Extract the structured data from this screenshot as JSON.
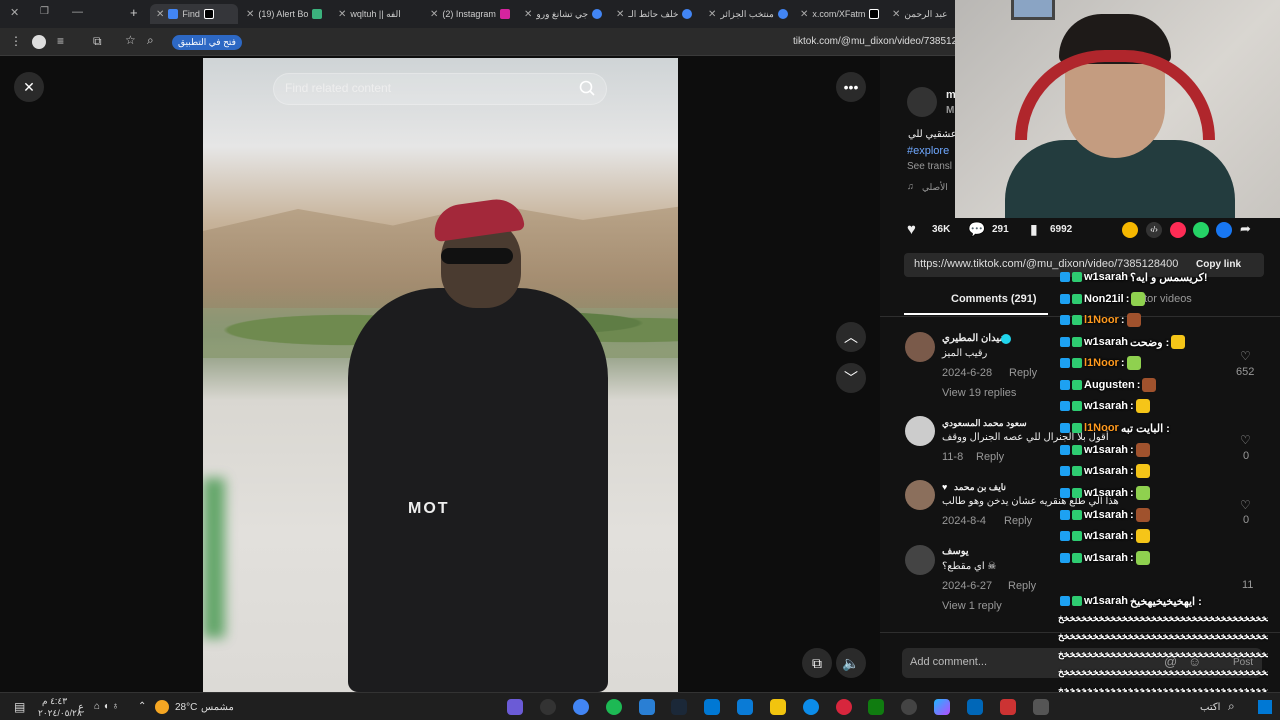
{
  "tabs": [
    {
      "label": "Find",
      "active": true
    },
    {
      "label": "(19) Alert Bo"
    },
    {
      "label": "wqltuh || الفه"
    },
    {
      "label": "(2) Instagram"
    },
    {
      "label": "جي تشانغ ورو"
    },
    {
      "label": "خلف حائط الـ"
    },
    {
      "label": "منتخب الجزائر"
    },
    {
      "label": "x.com/XFatm"
    },
    {
      "label": "عبد الرحمن"
    }
  ],
  "browser": {
    "open_in_app": "فتح في التطبيق",
    "url": "tiktok.com/@mu_dixon/video/7385128"
  },
  "video": {
    "search_placeholder": "Find related content",
    "watermark": "MOT",
    "close_icon": "close-icon",
    "more_icon": "more-icon"
  },
  "post": {
    "author_short": "m",
    "author_sub": "M",
    "caption": "عشقيي للي",
    "hashtag": "#explore",
    "see_translation": "See transl",
    "sound": "الأصلي",
    "likes": "36K",
    "comments": "291",
    "saves": "6992",
    "link": "https://www.tiktok.com/@mu_dixon/video/7385128400",
    "copy_link": "Copy link",
    "comments_tab": "Comments (291)",
    "creator_videos_tab": "ator videos",
    "add_comment": "Add comment...",
    "post_btn": "Post"
  },
  "comments": [
    {
      "name": "ضيدان المطيري",
      "text": "رقيب الميز",
      "date": "2024-6-28",
      "reply": "Reply",
      "replies": "View 19 replies",
      "likes": "652"
    },
    {
      "name": "سعود محمد المسعودي",
      "text": "أقول بلا الجنرال للي عصه الجنرال ووقف",
      "date": "11-8",
      "reply": "Reply",
      "likes": "0"
    },
    {
      "name": "نايف بن محمد",
      "text": "هذا الي طلع هنقريه عشان يدخن وهو طالب",
      "date": "2024-8-4",
      "reply": "Reply",
      "likes": "0"
    },
    {
      "name": "يوسف",
      "text": "اي مقطع؟ ☠",
      "date": "2024-6-27",
      "reply": "Reply",
      "replies": "View 1 reply",
      "likes": "11"
    }
  ],
  "chat": [
    {
      "user": "w1sarah",
      "text": "كريسمس و ايه؟!",
      "color": "#ffffff"
    },
    {
      "user": "Non21il",
      "text": ":",
      "color": "#ffffff"
    },
    {
      "user": "l1Noor",
      "text": ":",
      "color": "#ff9a1f"
    },
    {
      "user": "w1sarah",
      "text": "وضحت :",
      "color": "#ffffff"
    },
    {
      "user": "l1Noor",
      "text": ":",
      "color": "#ff9a1f"
    },
    {
      "user": "Augusten",
      "text": ":",
      "color": "#ffffff"
    },
    {
      "user": "w1sarah",
      "text": ":",
      "color": "#ffffff"
    },
    {
      "user": "l1Noor",
      "text": "البايت تبه :",
      "color": "#ff9a1f"
    },
    {
      "user": "w1sarah",
      "text": ":",
      "color": "#ffffff"
    },
    {
      "user": "w1sarah",
      "text": ":",
      "color": "#ffffff"
    },
    {
      "user": "w1sarah",
      "text": ":",
      "color": "#ffffff"
    },
    {
      "user": "w1sarah",
      "text": ":",
      "color": "#ffffff"
    },
    {
      "user": "w1sarah",
      "text": ":",
      "color": "#ffffff"
    },
    {
      "user": "w1sarah",
      "text": ":",
      "color": "#ffffff"
    },
    {
      "user": "w1sarah",
      "text": "ايهخيخيخيهخيخ :",
      "color": "#ffffff"
    }
  ],
  "chat_spam": "خخخخخخخخخخخخخخخخخخخخخخخخخخخخخخخخخخخخخخخخخخخخخخخخخخخخخخخخخخخخخخخخخخ",
  "chat_input_hint": "اكتب",
  "taskbar": {
    "time": "٤:٤٣ م",
    "date": "٢٠٢٤/٠٥/٢٨",
    "lang": "ع",
    "temp": "28°C",
    "weather": "مشمس"
  }
}
